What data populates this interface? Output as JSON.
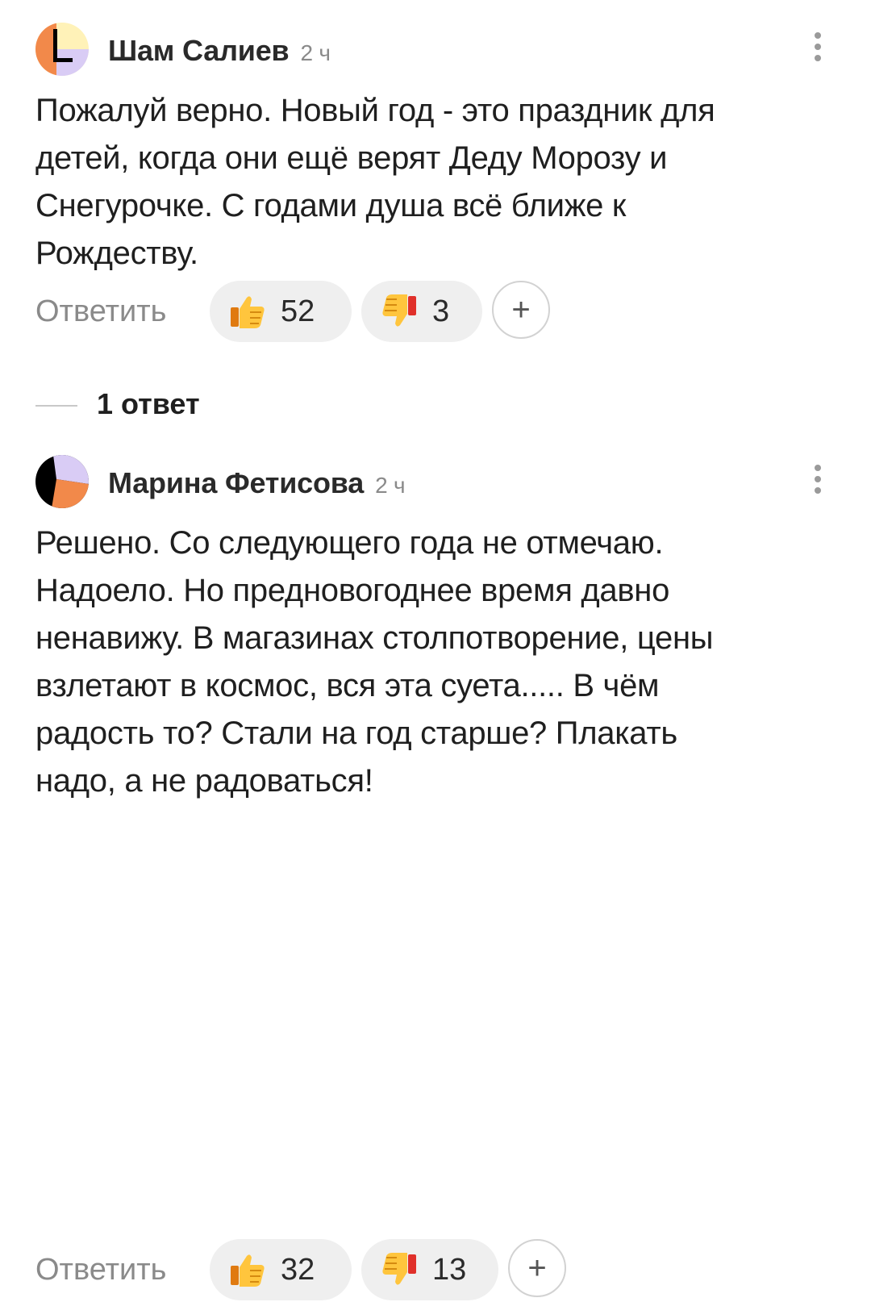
{
  "comments": [
    {
      "author": "Шам Салиев",
      "time": "2 ч",
      "avatar_icon": "avatar-yellow-orange-lavender",
      "text": "Пожалуй верно. Новый год - это праздник для\nдетей, когда они ещё верят Деду Морозу и\nСнегурочке. С годами душа всё ближе к\nРождеству.",
      "reply_label": "Ответить",
      "likes": "52",
      "dislikes": "3",
      "add_reaction": "+"
    },
    {
      "author": "Марина Фетисова",
      "time": "2 ч",
      "avatar_icon": "avatar-lavender-orange-black",
      "text": "Решено. Со следующего года не отмечаю.\nНадоело. Но предновогоднее время давно\nненавижу. В магазинах столпотворение, цены\nвзлетают в космос, вся эта суета..... В чём\nрадость то? Стали на год старше? Плакать\nнадо, а не радоваться!",
      "reply_label": "Ответить",
      "likes": "32",
      "dislikes": "13",
      "add_reaction": "+"
    }
  ],
  "replies_toggle": {
    "label": "1 ответ"
  },
  "colors": {
    "pill_bg": "#efefef",
    "muted_text": "#8a8a8a",
    "avatar_orange": "#f2894a",
    "avatar_yellow": "#fff2b8",
    "avatar_lavender": "#d9ccf5"
  }
}
